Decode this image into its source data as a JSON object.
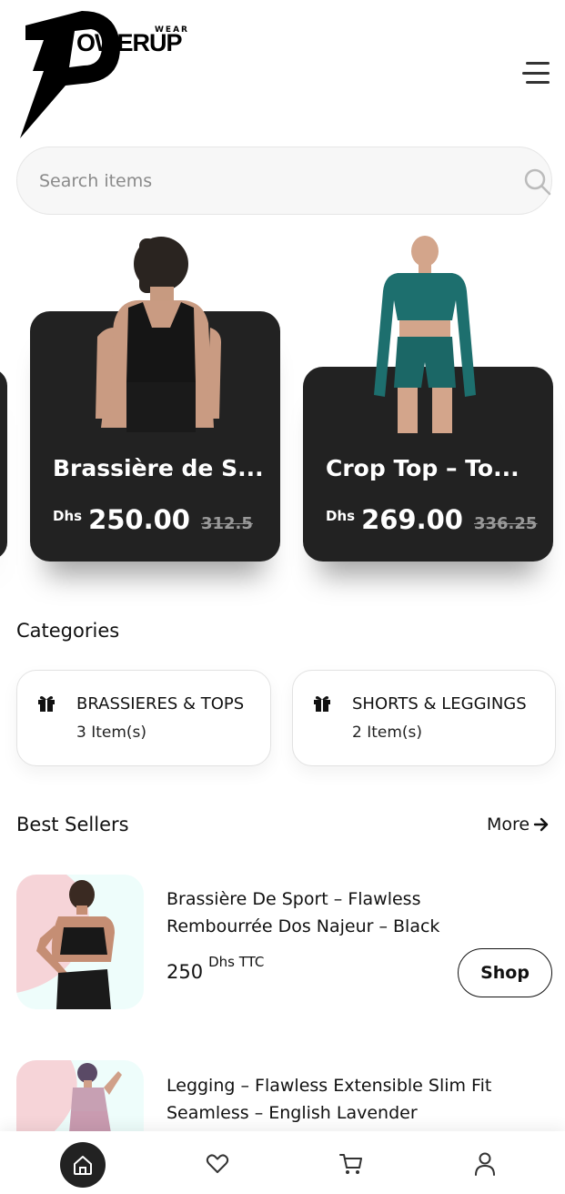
{
  "header": {
    "brand_main": "OWERUP",
    "brand_sub": "WEAR",
    "menu_icon": "hamburger-menu-icon"
  },
  "search": {
    "placeholder": "Search items",
    "icon": "search-icon"
  },
  "featured": [
    {
      "title": "Brassière de S...",
      "currency": "Dhs",
      "price": "250.00",
      "old_price": "312.5"
    },
    {
      "title": "Crop Top – To...",
      "currency": "Dhs",
      "price": "269.00",
      "old_price": "336.25"
    }
  ],
  "categories": {
    "title": "Categories",
    "items": [
      {
        "name": "BRASSIERES & TOPS",
        "count": "3 Item(s)",
        "icon": "gift-icon"
      },
      {
        "name": "SHORTS & LEGGINGS",
        "count": "2 Item(s)",
        "icon": "gift-icon"
      }
    ]
  },
  "best_sellers": {
    "title": "Best Sellers",
    "more_label": "More",
    "items": [
      {
        "name_line1": "Brassière De Sport – Flawless",
        "name_line2": "Rembourrée Dos Najeur – Black",
        "price": "250",
        "currency": "Dhs TTC",
        "button": "Shop"
      },
      {
        "name_line1": "Legging – Flawless Extensible Slim Fit",
        "name_line2": "Seamless – English Lavender"
      }
    ]
  },
  "bottom_nav": {
    "items": [
      "home-icon",
      "heart-icon",
      "cart-icon",
      "user-icon"
    ],
    "active": "home-icon"
  },
  "colors": {
    "card_dark": "#222222",
    "accent_teal": "#1a6b6b",
    "thumb_pink": "#f6d4d8",
    "thumb_mint": "#eefdfb"
  }
}
